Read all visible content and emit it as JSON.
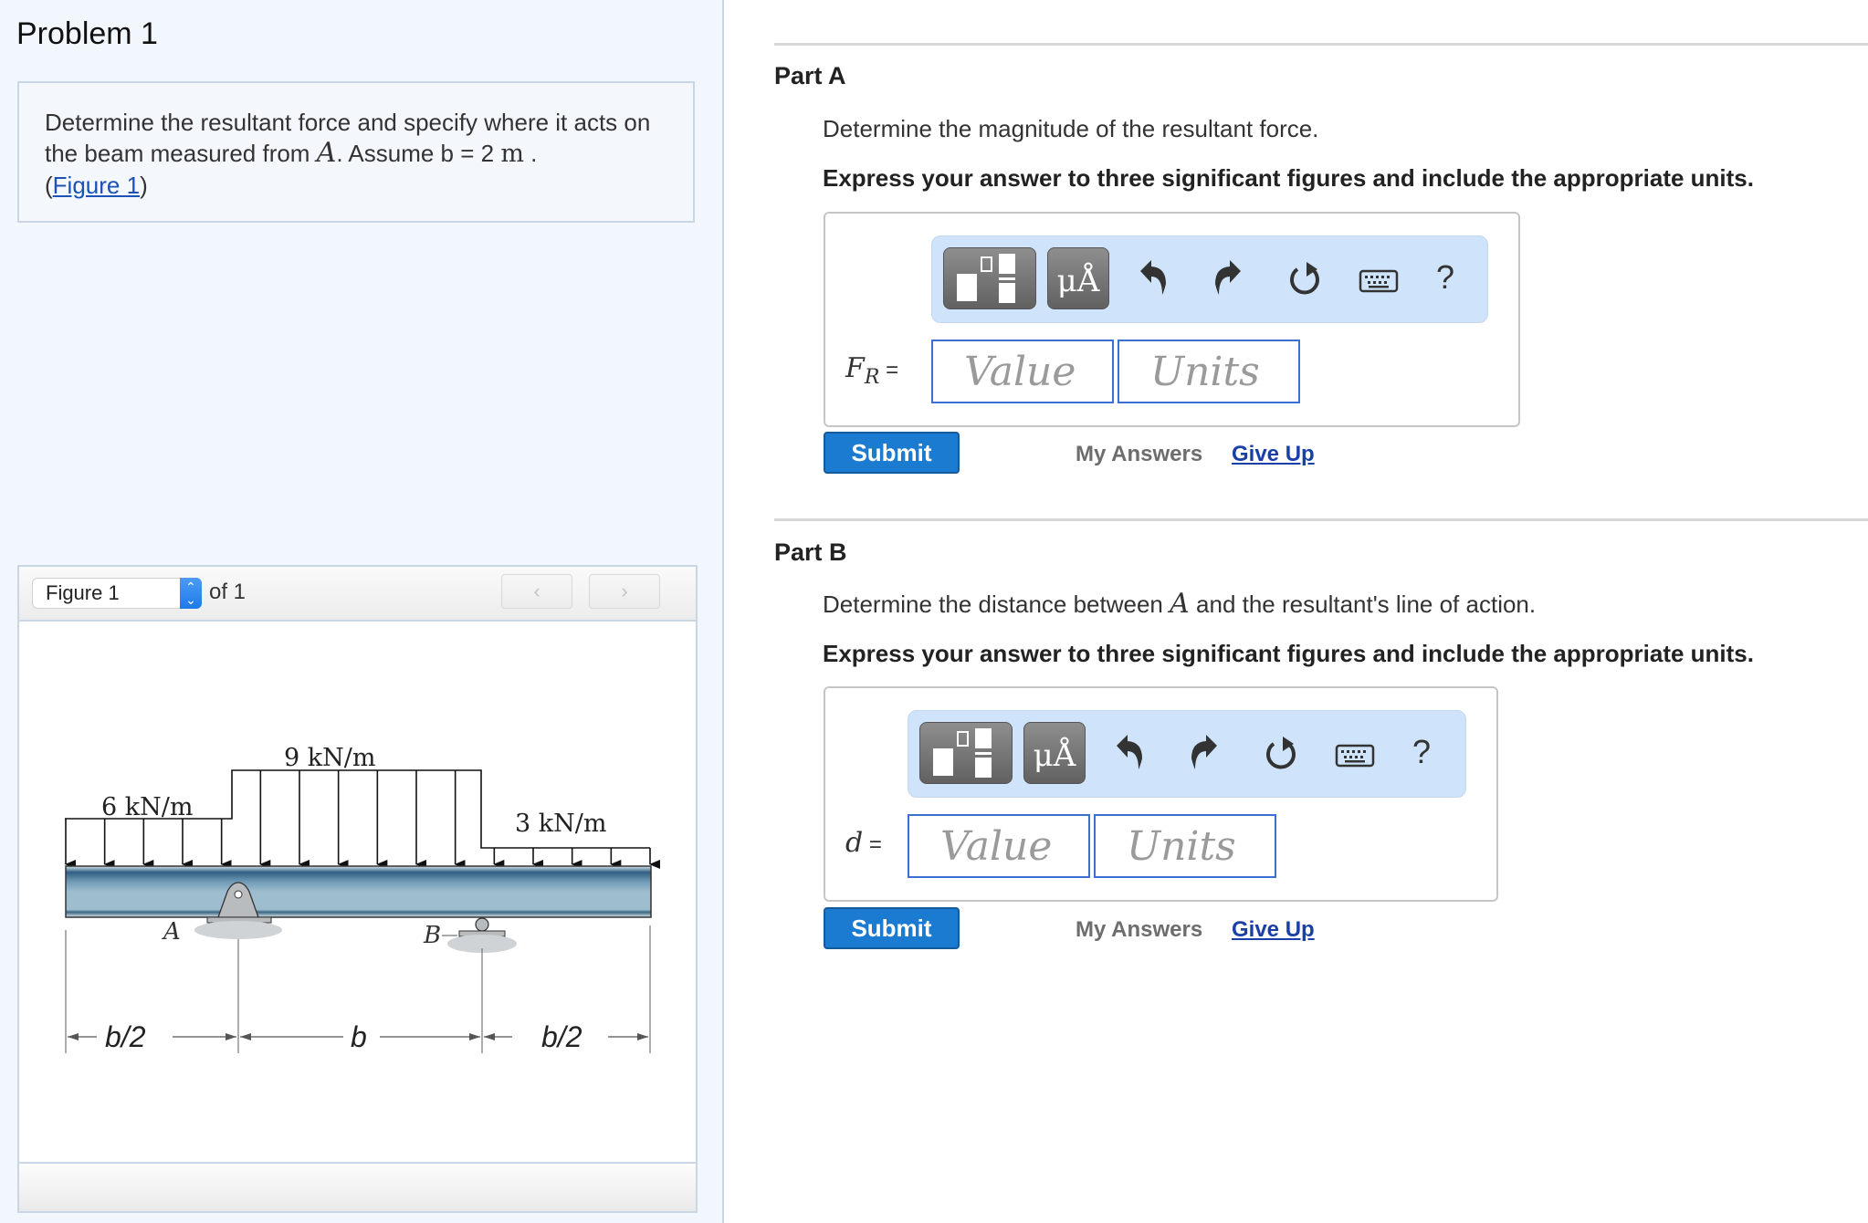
{
  "problem": {
    "title": "Problem 1",
    "statement_text_1": "Determine the resultant force and specify where it acts on the beam measured from ",
    "statement_var": "A",
    "statement_text_2": ". Assume b = 2 ",
    "statement_unit": "m",
    "statement_text_3": " .",
    "figure_link_open": "(",
    "figure_link": "Figure 1",
    "figure_link_close": ")"
  },
  "figure_viewer": {
    "selected": "Figure 1",
    "of_label": "of 1",
    "prev_icon": "‹",
    "next_icon": "›",
    "diagram": {
      "load_left": "6 kN/m",
      "load_middle": "9 kN/m",
      "load_right": "3 kN/m",
      "support_a": "A",
      "support_b": "B",
      "dim_left": "b/2",
      "dim_middle": "b",
      "dim_right": "b/2"
    }
  },
  "parts": [
    {
      "title": "Part A",
      "prompt": "Determine the magnitude of the resultant force.",
      "instructions": "Express your answer to three significant figures and include the appropriate units.",
      "var_main": "F",
      "var_sub": "R",
      "equals": " =",
      "value_placeholder": "Value",
      "units_placeholder": "Units",
      "submit_label": "Submit",
      "my_answers_label": "My Answers",
      "give_up_label": "Give Up"
    },
    {
      "title": "Part B",
      "prompt_1": "Determine the distance between ",
      "prompt_var": "A",
      "prompt_2": " and the resultant's line of action.",
      "instructions": "Express your answer to three significant figures and include the appropriate units.",
      "var_main": "d",
      "equals": " =",
      "value_placeholder": "Value",
      "units_placeholder": "Units",
      "submit_label": "Submit",
      "my_answers_label": "My Answers",
      "give_up_label": "Give Up"
    }
  ],
  "toolbar": {
    "templates_icon": "templates-icon",
    "symbols_label": "μÅ",
    "undo_icon": "undo-icon",
    "redo_icon": "redo-icon",
    "reset_icon": "reset-icon",
    "keyboard_icon": "keyboard-icon",
    "help_label": "?"
  }
}
